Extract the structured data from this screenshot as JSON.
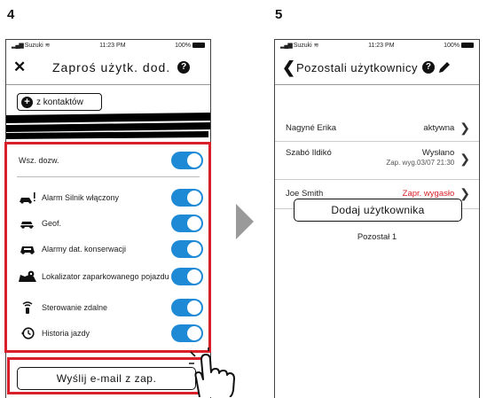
{
  "steps": {
    "left": "4",
    "right": "5"
  },
  "left_phone": {
    "status": {
      "carrier": "Suzuki",
      "time": "11:23 PM",
      "battery": "100%"
    },
    "title": "Zaproś użytk. dod.",
    "help_label": "?",
    "contacts_button": "z kontaktów",
    "permissions": [
      {
        "label": "Wsz. dozw.",
        "icon": "none",
        "enabled": true
      },
      {
        "label": "Alarm Silnik włączony",
        "icon": "car-alert-icon",
        "enabled": true
      },
      {
        "label": "Geof.",
        "icon": "car-geofence-icon",
        "enabled": true
      },
      {
        "label": "Alarmy dat. konserwacji",
        "icon": "car-maintenance-icon",
        "enabled": true
      },
      {
        "label": "Lokalizator zaparkowanego pojazdu",
        "icon": "map-pin-icon",
        "enabled": true
      },
      {
        "label": "Sterowanie zdalne",
        "icon": "remote-control-icon",
        "enabled": true
      },
      {
        "label": "Historia jazdy",
        "icon": "history-icon",
        "enabled": true
      }
    ],
    "send_button": "Wyślij e-mail z zap."
  },
  "right_phone": {
    "status": {
      "carrier": "Suzuki",
      "time": "11:23 PM",
      "battery": "100%"
    },
    "title": "Pozostali użytkownicy",
    "help_label": "?",
    "users": [
      {
        "name": "Nagyné Erika",
        "status": "aktywna",
        "detail": "",
        "status_color": "#222222"
      },
      {
        "name": "Szabó Ildikó",
        "status": "Wysłano",
        "detail": "Zap. wyg.03/07 21:30",
        "status_color": "#222222"
      },
      {
        "name": "Joe Smith",
        "status": "Zapr. wygasło",
        "detail": "",
        "status_color": "#d9202a"
      }
    ],
    "add_button": "Dodaj użytkownika",
    "remaining": "Pozostał 1"
  },
  "colors": {
    "accent": "#1e8ad6",
    "highlight": "#d9202a"
  }
}
